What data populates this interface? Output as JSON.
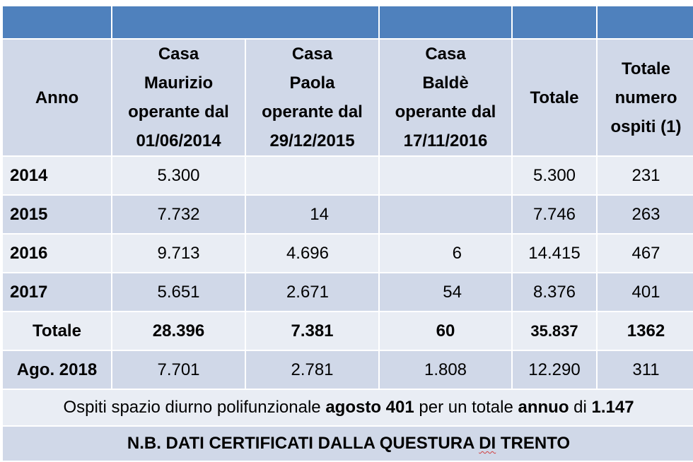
{
  "header": {
    "col_anno": "Anno",
    "col_casa_maurizio": [
      "Casa",
      "Maurizio",
      "operante dal",
      "01/06/2014"
    ],
    "col_casa_paola": [
      "Casa",
      "Paola",
      "operante dal",
      "29/12/2015"
    ],
    "col_casa_balde": [
      "Casa",
      "Baldè",
      "operante dal",
      "17/11/2016"
    ],
    "col_totale": "Totale",
    "col_totale_ospiti": [
      "Totale",
      "numero",
      "ospiti (1)"
    ]
  },
  "rows": [
    {
      "anno": "2014",
      "maurizio": "5.300",
      "paola": "",
      "balde": "",
      "totale": "5.300",
      "ospiti": "231"
    },
    {
      "anno": "2015",
      "maurizio": "7.732",
      "paola": "14",
      "balde": "",
      "totale": "7.746",
      "ospiti": "263"
    },
    {
      "anno": "2016",
      "maurizio": "9.713",
      "paola": "4.696",
      "balde": "6",
      "totale": "14.415",
      "ospiti": "467"
    },
    {
      "anno": "2017",
      "maurizio": "5.651",
      "paola": "2.671",
      "balde": "54",
      "totale": "8.376",
      "ospiti": "401"
    },
    {
      "anno": "Totale",
      "maurizio": "28.396",
      "paola": "7.381",
      "balde": "60",
      "totale": "35.837",
      "ospiti": "1362"
    },
    {
      "anno": "Ago. 2018",
      "maurizio": "7.701",
      "paola": "2.781",
      "balde": "1.808",
      "totale": "12.290",
      "ospiti": "311"
    }
  ],
  "note": {
    "part1": "Ospiti spazio diurno polifunzionale ",
    "bold1": "agosto 401",
    "part2": " per un totale ",
    "bold2": "annuo",
    "part3": " di ",
    "bold3": "1.147"
  },
  "nb": {
    "text_before": "N.B. DATI CERTIFICATI DALLA QUESTURA ",
    "text_di": "DI",
    "text_after": " TRENTO"
  }
}
